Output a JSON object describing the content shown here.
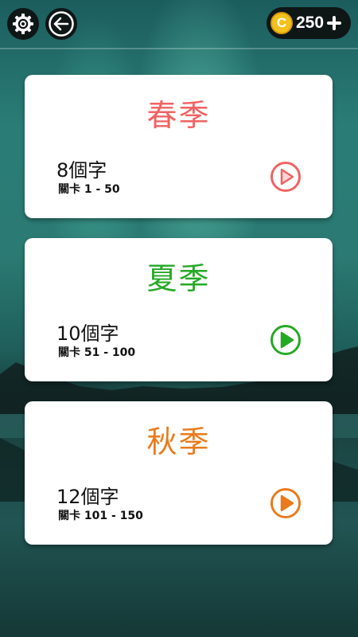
{
  "topbar": {
    "settings_icon": "gear-icon",
    "back_icon": "back-arrow-icon",
    "coin_symbol": "C",
    "coin_balance": "250",
    "add_icon": "plus-icon"
  },
  "colors": {
    "spring": "#f16262",
    "summer": "#25a925",
    "autumn": "#ea7a1c",
    "spring_play_fill": "#fdd5d5",
    "card_bg": "#ffffff",
    "topbar_button_bg": "#0e1616",
    "coin": "#f4c21e"
  },
  "seasons": [
    {
      "title": "春季",
      "word_count": "8個字",
      "levels": "關卡 1 - 50",
      "play_icon": "play-icon"
    },
    {
      "title": "夏季",
      "word_count": "10個字",
      "levels": "關卡 51 - 100",
      "play_icon": "play-icon"
    },
    {
      "title": "秋季",
      "word_count": "12個字",
      "levels": "關卡 101 - 150",
      "play_icon": "play-icon"
    }
  ]
}
